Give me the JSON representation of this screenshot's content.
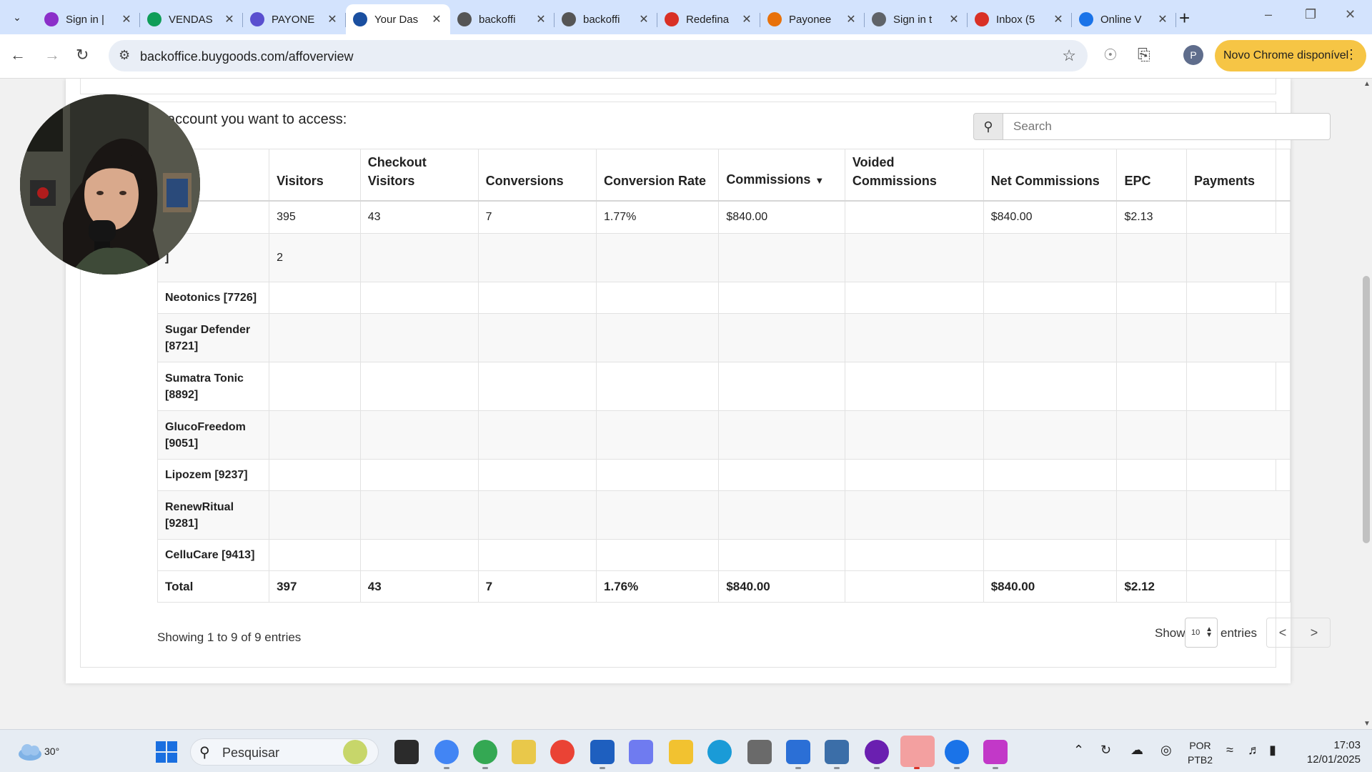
{
  "browser": {
    "tabs": [
      {
        "title": "Sign in |",
        "favicon": "m-logo-icon",
        "color": "#8b2fc9"
      },
      {
        "title": "VENDAS",
        "favicon": "sheets-icon",
        "color": "#0f9d58"
      },
      {
        "title": "PAYONE",
        "favicon": "gear-flower-icon",
        "color": "#5a4fcf"
      },
      {
        "title": "Your Das",
        "favicon": "bg-logo-icon",
        "color": "#1a4fa0",
        "active": true
      },
      {
        "title": "backoffi",
        "favicon": "globe-icon",
        "color": "#555555"
      },
      {
        "title": "backoffi",
        "favicon": "globe-icon",
        "color": "#555555"
      },
      {
        "title": "Redefina",
        "favicon": "gmail-icon",
        "color": "#d93025"
      },
      {
        "title": "Payonee",
        "favicon": "loading-icon",
        "color": "#e8710a"
      },
      {
        "title": "Sign in t",
        "favicon": "loading-icon",
        "color": "#5f6368"
      },
      {
        "title": "Inbox (5",
        "favicon": "gmail-icon",
        "color": "#d93025"
      },
      {
        "title": "Online V",
        "favicon": "people-icon",
        "color": "#1a73e8"
      }
    ],
    "url": "backoffice.buygoods.com/affoverview",
    "profile_initial": "P",
    "update_button": "Novo Chrome disponível"
  },
  "page": {
    "prompt": "account you want to access:",
    "search_placeholder": "Search",
    "table": {
      "headers": [
        "",
        "Visitors",
        "Checkout Visitors",
        "Conversions",
        "Conversion Rate",
        "Commissions",
        "Voided Commissions",
        "Net Commissions",
        "EPC",
        "Payments"
      ],
      "sorted_column": "Commissions",
      "rows": [
        {
          "name": "]",
          "values": [
            "395",
            "43",
            "7",
            "1.77%",
            "$840.00",
            "",
            "$840.00",
            "$2.13",
            ""
          ]
        },
        {
          "name": "]",
          "values": [
            "2",
            "",
            "",
            "",
            "",
            "",
            "",
            "",
            ""
          ]
        },
        {
          "name": "Neotonics [7726]",
          "values": [
            "",
            "",
            "",
            "",
            "",
            "",
            "",
            "",
            ""
          ]
        },
        {
          "name": "Sugar Defender [8721]",
          "values": [
            "",
            "",
            "",
            "",
            "",
            "",
            "",
            "",
            ""
          ]
        },
        {
          "name": "Sumatra Tonic [8892]",
          "values": [
            "",
            "",
            "",
            "",
            "",
            "",
            "",
            "",
            ""
          ]
        },
        {
          "name": "GlucoFreedom [9051]",
          "values": [
            "",
            "",
            "",
            "",
            "",
            "",
            "",
            "",
            ""
          ]
        },
        {
          "name": "Lipozem [9237]",
          "values": [
            "",
            "",
            "",
            "",
            "",
            "",
            "",
            "",
            ""
          ]
        },
        {
          "name": "RenewRitual [9281]",
          "values": [
            "",
            "",
            "",
            "",
            "",
            "",
            "",
            "",
            ""
          ]
        },
        {
          "name": "CelluCare [9413]",
          "values": [
            "",
            "",
            "",
            "",
            "",
            "",
            "",
            "",
            ""
          ]
        }
      ],
      "total": {
        "name": "Total",
        "values": [
          "397",
          "43",
          "7",
          "1.76%",
          "$840.00",
          "",
          "$840.00",
          "$2.12",
          ""
        ]
      }
    },
    "info": "Showing 1 to 9 of 9 entries",
    "show_label": "Show",
    "page_length": "10",
    "entries_label": "entries",
    "prev": "<",
    "next": ">"
  },
  "taskbar": {
    "temperature": "30°",
    "search_placeholder": "Pesquisar",
    "language": "POR",
    "keyboard": "PTB2",
    "time": "17:03",
    "date": "12/01/2025"
  }
}
